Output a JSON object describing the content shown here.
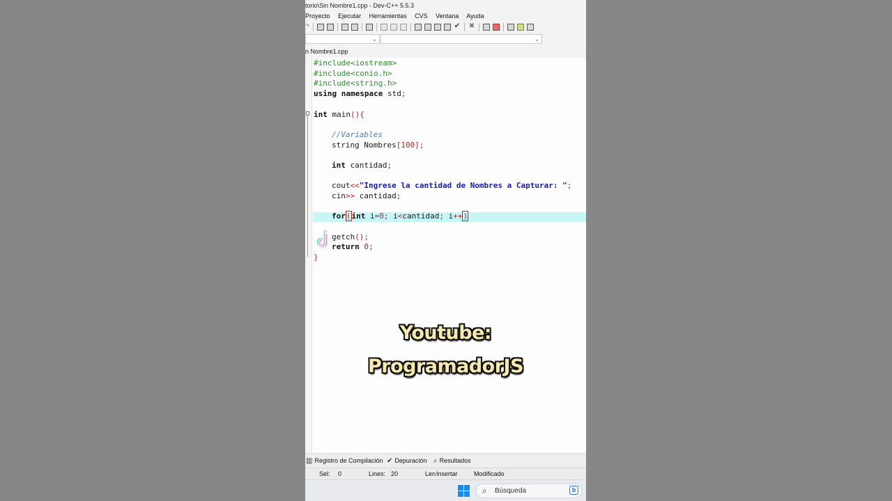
{
  "window": {
    "title": "torio\\Sin Nombre1.cpp - Dev-C++ 5.5.3"
  },
  "menu": [
    "Proyecto",
    "Ejecutar",
    "Herramientas",
    "CVS",
    "Ventana",
    "Ayuda"
  ],
  "editor_tab": {
    "label": "n Nombre1.cpp"
  },
  "code": {
    "l1": "#include<iostream>",
    "l2": "#include<conio.h>",
    "l3": "#include<string.h>",
    "l4_kw": "using namespace",
    "l4_rest": " std",
    "semi": ";",
    "int_kw": "int",
    "main_name": " main",
    "paren_open": "(",
    "paren_close": ")",
    "brace_open": "{",
    "brace_close": "}",
    "comment": "//Variables",
    "string_decl": "string Nombres",
    "bracket_open": "[",
    "bracket_close": "]",
    "num_100": "100",
    "cantidad_decl": " cantidad",
    "cout": "cout",
    "op_out": "<<",
    "string_literal": "\"Ingrese la cantidad de Nombres a Capturar: \"",
    "cin": "cin",
    "op_in": ">>",
    "cin_rest": " cantidad",
    "for_kw": "for",
    "for_int": "int",
    "for_i": " i",
    "eq": "=",
    "num_0": "0",
    "for_cond": " i",
    "lt": "<",
    "for_cond2": "cantidad",
    "for_inc": " i",
    "plusplus": "++",
    "getch": "getch",
    "return_kw": "return",
    "return_val": " 0"
  },
  "overlay": {
    "line1": "Youtube:",
    "line2": "ProgramadorJS"
  },
  "bottom_tabs": [
    "Registro de Compilación",
    "Depuración",
    "Resultados"
  ],
  "status": {
    "sel_label": "Sel:",
    "sel_value": "0",
    "lines_label": "Lines:",
    "lines_value": "20",
    "len_label": "Len",
    "mode": "Insertar",
    "modified": "Modificado"
  },
  "taskbar": {
    "search_placeholder": "Búsqueda"
  },
  "colors": {
    "accent": "#1a8cf0",
    "highlight": "#c6f6f6",
    "include": "#2f8a2f",
    "comment": "#4b7fb3"
  }
}
